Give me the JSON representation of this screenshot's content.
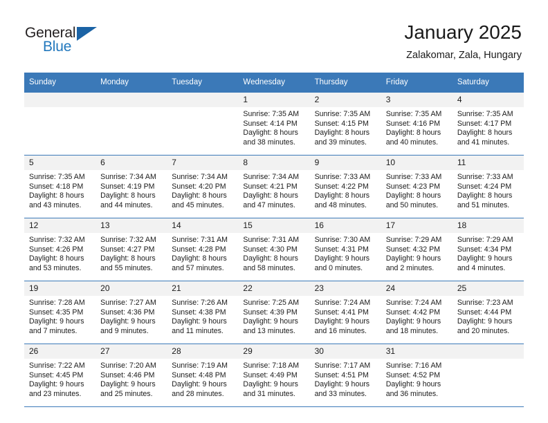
{
  "brand": {
    "name_top": "General",
    "name_bottom": "Blue",
    "accent_color": "#2278bd",
    "triangle_color": "#1b63a5"
  },
  "header": {
    "title": "January 2025",
    "subtitle": "Zalakomar, Zala, Hungary"
  },
  "theme": {
    "header_bg": "#3b79b8",
    "daynum_bg": "#f2f2f2",
    "grid_line": "#3b79b8",
    "text": "#1a1a1a"
  },
  "weekdays": [
    "Sunday",
    "Monday",
    "Tuesday",
    "Wednesday",
    "Thursday",
    "Friday",
    "Saturday"
  ],
  "weeks": [
    [
      {
        "day": "",
        "lines": []
      },
      {
        "day": "",
        "lines": []
      },
      {
        "day": "",
        "lines": []
      },
      {
        "day": "1",
        "lines": [
          "Sunrise: 7:35 AM",
          "Sunset: 4:14 PM",
          "Daylight: 8 hours",
          "and 38 minutes."
        ]
      },
      {
        "day": "2",
        "lines": [
          "Sunrise: 7:35 AM",
          "Sunset: 4:15 PM",
          "Daylight: 8 hours",
          "and 39 minutes."
        ]
      },
      {
        "day": "3",
        "lines": [
          "Sunrise: 7:35 AM",
          "Sunset: 4:16 PM",
          "Daylight: 8 hours",
          "and 40 minutes."
        ]
      },
      {
        "day": "4",
        "lines": [
          "Sunrise: 7:35 AM",
          "Sunset: 4:17 PM",
          "Daylight: 8 hours",
          "and 41 minutes."
        ]
      }
    ],
    [
      {
        "day": "5",
        "lines": [
          "Sunrise: 7:35 AM",
          "Sunset: 4:18 PM",
          "Daylight: 8 hours",
          "and 43 minutes."
        ]
      },
      {
        "day": "6",
        "lines": [
          "Sunrise: 7:34 AM",
          "Sunset: 4:19 PM",
          "Daylight: 8 hours",
          "and 44 minutes."
        ]
      },
      {
        "day": "7",
        "lines": [
          "Sunrise: 7:34 AM",
          "Sunset: 4:20 PM",
          "Daylight: 8 hours",
          "and 45 minutes."
        ]
      },
      {
        "day": "8",
        "lines": [
          "Sunrise: 7:34 AM",
          "Sunset: 4:21 PM",
          "Daylight: 8 hours",
          "and 47 minutes."
        ]
      },
      {
        "day": "9",
        "lines": [
          "Sunrise: 7:33 AM",
          "Sunset: 4:22 PM",
          "Daylight: 8 hours",
          "and 48 minutes."
        ]
      },
      {
        "day": "10",
        "lines": [
          "Sunrise: 7:33 AM",
          "Sunset: 4:23 PM",
          "Daylight: 8 hours",
          "and 50 minutes."
        ]
      },
      {
        "day": "11",
        "lines": [
          "Sunrise: 7:33 AM",
          "Sunset: 4:24 PM",
          "Daylight: 8 hours",
          "and 51 minutes."
        ]
      }
    ],
    [
      {
        "day": "12",
        "lines": [
          "Sunrise: 7:32 AM",
          "Sunset: 4:26 PM",
          "Daylight: 8 hours",
          "and 53 minutes."
        ]
      },
      {
        "day": "13",
        "lines": [
          "Sunrise: 7:32 AM",
          "Sunset: 4:27 PM",
          "Daylight: 8 hours",
          "and 55 minutes."
        ]
      },
      {
        "day": "14",
        "lines": [
          "Sunrise: 7:31 AM",
          "Sunset: 4:28 PM",
          "Daylight: 8 hours",
          "and 57 minutes."
        ]
      },
      {
        "day": "15",
        "lines": [
          "Sunrise: 7:31 AM",
          "Sunset: 4:30 PM",
          "Daylight: 8 hours",
          "and 58 minutes."
        ]
      },
      {
        "day": "16",
        "lines": [
          "Sunrise: 7:30 AM",
          "Sunset: 4:31 PM",
          "Daylight: 9 hours",
          "and 0 minutes."
        ]
      },
      {
        "day": "17",
        "lines": [
          "Sunrise: 7:29 AM",
          "Sunset: 4:32 PM",
          "Daylight: 9 hours",
          "and 2 minutes."
        ]
      },
      {
        "day": "18",
        "lines": [
          "Sunrise: 7:29 AM",
          "Sunset: 4:34 PM",
          "Daylight: 9 hours",
          "and 4 minutes."
        ]
      }
    ],
    [
      {
        "day": "19",
        "lines": [
          "Sunrise: 7:28 AM",
          "Sunset: 4:35 PM",
          "Daylight: 9 hours",
          "and 7 minutes."
        ]
      },
      {
        "day": "20",
        "lines": [
          "Sunrise: 7:27 AM",
          "Sunset: 4:36 PM",
          "Daylight: 9 hours",
          "and 9 minutes."
        ]
      },
      {
        "day": "21",
        "lines": [
          "Sunrise: 7:26 AM",
          "Sunset: 4:38 PM",
          "Daylight: 9 hours",
          "and 11 minutes."
        ]
      },
      {
        "day": "22",
        "lines": [
          "Sunrise: 7:25 AM",
          "Sunset: 4:39 PM",
          "Daylight: 9 hours",
          "and 13 minutes."
        ]
      },
      {
        "day": "23",
        "lines": [
          "Sunrise: 7:24 AM",
          "Sunset: 4:41 PM",
          "Daylight: 9 hours",
          "and 16 minutes."
        ]
      },
      {
        "day": "24",
        "lines": [
          "Sunrise: 7:24 AM",
          "Sunset: 4:42 PM",
          "Daylight: 9 hours",
          "and 18 minutes."
        ]
      },
      {
        "day": "25",
        "lines": [
          "Sunrise: 7:23 AM",
          "Sunset: 4:44 PM",
          "Daylight: 9 hours",
          "and 20 minutes."
        ]
      }
    ],
    [
      {
        "day": "26",
        "lines": [
          "Sunrise: 7:22 AM",
          "Sunset: 4:45 PM",
          "Daylight: 9 hours",
          "and 23 minutes."
        ]
      },
      {
        "day": "27",
        "lines": [
          "Sunrise: 7:20 AM",
          "Sunset: 4:46 PM",
          "Daylight: 9 hours",
          "and 25 minutes."
        ]
      },
      {
        "day": "28",
        "lines": [
          "Sunrise: 7:19 AM",
          "Sunset: 4:48 PM",
          "Daylight: 9 hours",
          "and 28 minutes."
        ]
      },
      {
        "day": "29",
        "lines": [
          "Sunrise: 7:18 AM",
          "Sunset: 4:49 PM",
          "Daylight: 9 hours",
          "and 31 minutes."
        ]
      },
      {
        "day": "30",
        "lines": [
          "Sunrise: 7:17 AM",
          "Sunset: 4:51 PM",
          "Daylight: 9 hours",
          "and 33 minutes."
        ]
      },
      {
        "day": "31",
        "lines": [
          "Sunrise: 7:16 AM",
          "Sunset: 4:52 PM",
          "Daylight: 9 hours",
          "and 36 minutes."
        ]
      },
      {
        "day": "",
        "lines": []
      }
    ]
  ]
}
